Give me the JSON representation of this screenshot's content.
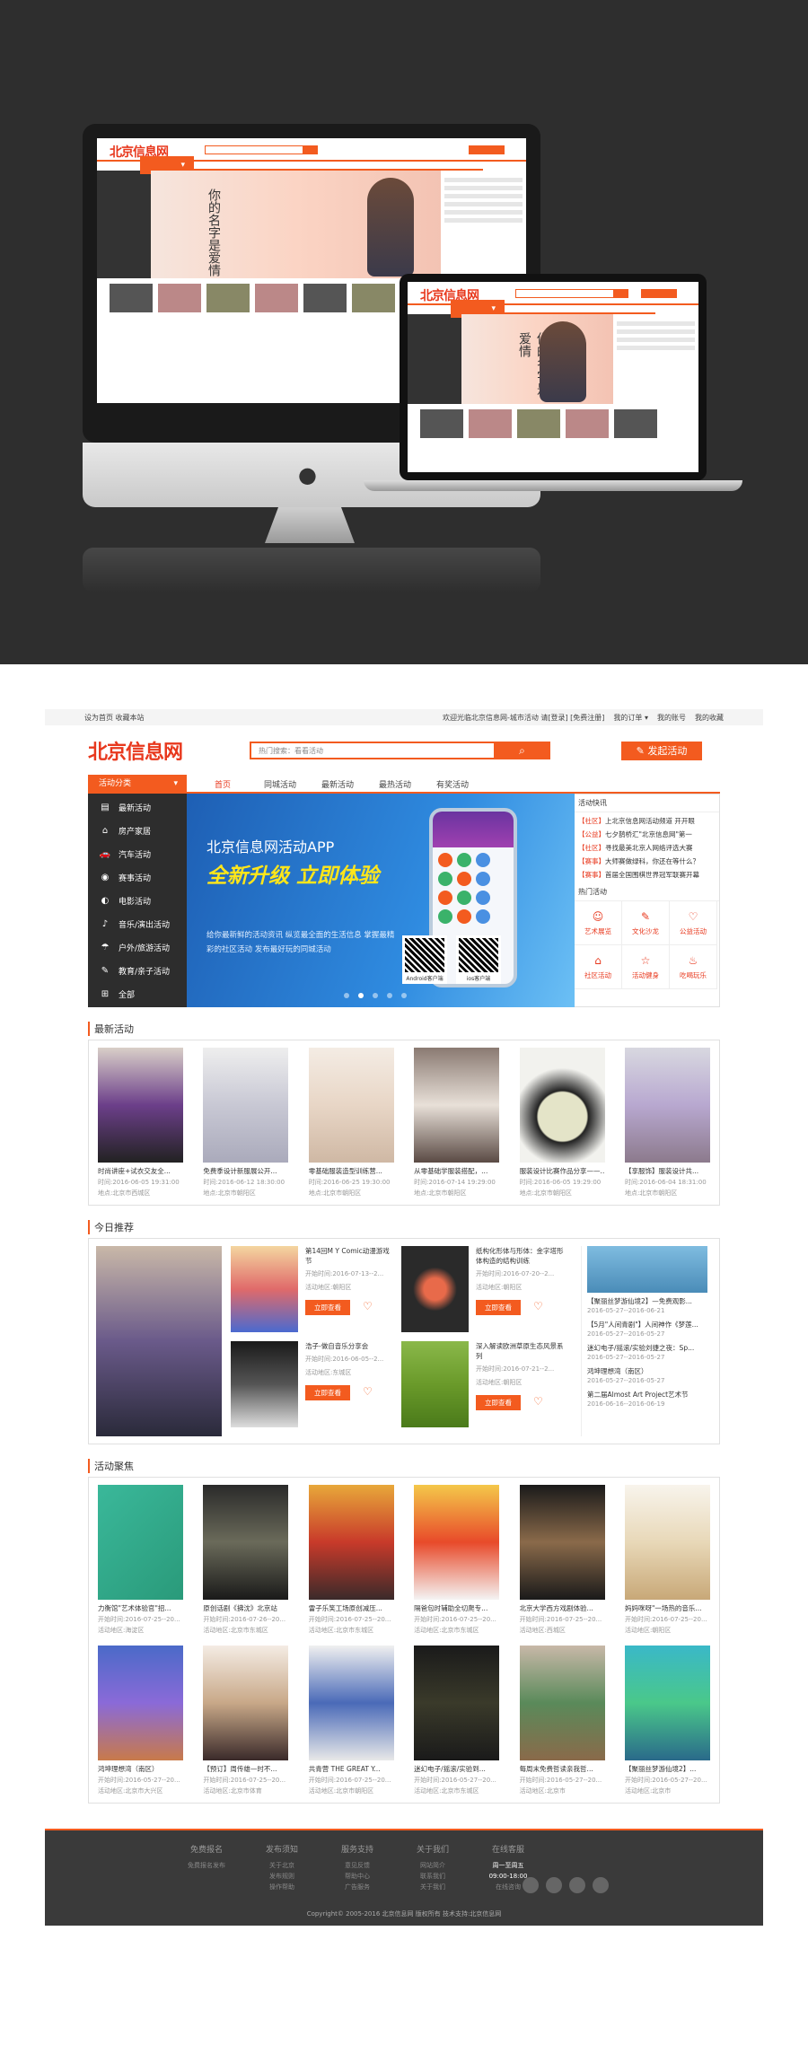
{
  "topbar": {
    "left": "设为首页 收藏本站",
    "welcome": "欢迎光临北京信息网-城市活动 请[登录] [免费注册]",
    "orders": "我的订单 ▾",
    "account": "我的账号",
    "favs": "我的收藏"
  },
  "header": {
    "logo": "北京信息网",
    "search_placeholder": "热门搜索：看看活动",
    "publish": "发起活动"
  },
  "nav": {
    "category": "活动分类",
    "items": [
      "首页",
      "同城活动",
      "最新活动",
      "最热活动",
      "有奖活动"
    ]
  },
  "sidebar": [
    {
      "icon": "▤",
      "label": "最新活动"
    },
    {
      "icon": "⌂",
      "label": "房产家居"
    },
    {
      "icon": "🚗",
      "label": "汽车活动"
    },
    {
      "icon": "◉",
      "label": "赛事活动"
    },
    {
      "icon": "◐",
      "label": "电影活动"
    },
    {
      "icon": "♪",
      "label": "音乐/演出活动"
    },
    {
      "icon": "☂",
      "label": "户外/旅游活动"
    },
    {
      "icon": "✎",
      "label": "教育/亲子活动"
    },
    {
      "icon": "⊞",
      "label": "全部"
    }
  ],
  "banner": {
    "title": "北京信息网活动APP",
    "headline": "全新升级 立即体验",
    "desc": "给你最新鲜的活动资讯 纵览最全面的生活信息 掌握最精彩的社区活动 发布最好玩的同城活动",
    "android": "Android客户端",
    "ios": "ios客户端"
  },
  "aside": {
    "news_title": "活动快讯",
    "news": [
      {
        "tag": "【社区】",
        "text": "上北京信息网活动频道 开开眼"
      },
      {
        "tag": "【公益】",
        "text": "七夕鹊桥汇\"北京信息网\"第一"
      },
      {
        "tag": "【社区】",
        "text": "寻找最美北京人网络评选大赛"
      },
      {
        "tag": "【赛事】",
        "text": "大师赛做绿科，你还在等什么？"
      },
      {
        "tag": "【赛事】",
        "text": "首届全国围棋世界冠军联赛开幕"
      }
    ],
    "hot_title": "热门活动",
    "hot": [
      {
        "icon": "☺",
        "label": "艺术展览"
      },
      {
        "icon": "✎",
        "label": "文化沙龙"
      },
      {
        "icon": "♡",
        "label": "公益活动"
      },
      {
        "icon": "⌂",
        "label": "社区活动"
      },
      {
        "icon": "☆",
        "label": "活动健身"
      },
      {
        "icon": "♨",
        "label": "吃喝玩乐"
      }
    ]
  },
  "latest": {
    "title": "最新活动",
    "items": [
      {
        "title": "时尚讲座+试衣交友全...",
        "time": "时间:2016-06-05 19:31:00",
        "place": "地点:北京市西城区"
      },
      {
        "title": "免费季设计新服展公开...",
        "time": "时间:2016-06-12 18:30:00",
        "place": "地点:北京市朝阳区"
      },
      {
        "title": "零基础服装造型训练营...",
        "time": "时间:2016-06-25 19:30:00",
        "place": "地点:北京市朝阳区"
      },
      {
        "title": "从零基础学服装搭配，...",
        "time": "时间:2016-07-14 19:29:00",
        "place": "地点:北京市朝阳区"
      },
      {
        "title": "服装设计比赛作品分享——...",
        "time": "时间:2016-06-05 19:29:00",
        "place": "地点:北京市朝阳区"
      },
      {
        "title": "【享服饰】服装设计共...",
        "time": "时间:2016-06-04 18:31:00",
        "place": "地点:北京市朝阳区"
      }
    ]
  },
  "today": {
    "title": "今日推荐",
    "items": [
      {
        "title": "第14回M Y Comic动漫游戏节",
        "time": "开始时间:2016-07-13--2...",
        "place": "活动地区:朝阳区"
      },
      {
        "title": "纸构化形体与形体：金字塔形体构造的结构训练",
        "time": "开始时间:2016-07-20--2...",
        "place": "活动地区:朝阳区"
      },
      {
        "title": "浩子-做自音乐分享会",
        "time": "开始时间:2016-06-05--2...",
        "place": "活动地区:东城区"
      },
      {
        "title": "深入解读欧洲草原生态风景系列",
        "time": "开始时间:2016-07-21--2...",
        "place": "活动地区:朝阳区"
      }
    ],
    "button": "立即查看",
    "list": [
      {
        "title": "【聚丽丝梦游仙境2】—免费观影...",
        "meta": "2016-05-27--2016-06-21"
      },
      {
        "title": "【5月\"人间青剧\"】人间神作《梦莲...",
        "meta": "2016-05-27--2016-05-27"
      },
      {
        "title": "迷幻电子/摇滚/实验刘捷之夜：Sp...",
        "meta": "2016-05-27--2016-05-27"
      },
      {
        "title": "鸿坤理想湾（南区）",
        "meta": "2016-05-27--2016-05-27"
      },
      {
        "title": "第二届Almost Art Project艺术节",
        "meta": "2016-06-16--2016-06-19"
      }
    ]
  },
  "focus": {
    "title": "活动聚焦",
    "items": [
      {
        "title": "力衡馆\"艺术体验官\"招...",
        "time": "开始时间:2016-07-25--20...",
        "place": "活动地区:海淀区"
      },
      {
        "title": "原创话剧《拂沈》北京站",
        "time": "开始时间:2016-07-26--20...",
        "place": "活动地区:北京市东城区"
      },
      {
        "title": "雷子乐笑工场原创减压...",
        "time": "开始时间:2016-07-25--20...",
        "place": "活动地区:北京市东城区"
      },
      {
        "title": "隔爸包时辅助全切爬专...",
        "time": "开始时间:2016-07-25--20...",
        "place": "活动地区:北京市东城区"
      },
      {
        "title": "北京大学西方戏剧体验...",
        "time": "开始时间:2016-07-25--20...",
        "place": "活动地区:西城区"
      },
      {
        "title": "妈妈咪呀\"一场热的音乐...",
        "time": "开始时间:2016-07-25--20...",
        "place": "活动地区:朝阳区"
      },
      {
        "title": "鸿坤理想湾（南区）",
        "time": "开始时间:2016-05-27--20...",
        "place": "活动地区:北京市大兴区"
      },
      {
        "title": "【预订】周传雄—时不...",
        "time": "开始时间:2016-07-25--20...",
        "place": "活动地区:北京市体育"
      },
      {
        "title": "共青营 THE GREAT Y...",
        "time": "开始时间:2016-07-25--20...",
        "place": "活动地区:北京市朝阳区"
      },
      {
        "title": "迷幻电子/摇滚/实验到...",
        "time": "开始时间:2016-05-27--20...",
        "place": "活动地区:北京市东城区"
      },
      {
        "title": "每周末免费哲读亲我哲...",
        "time": "开始时间:2016-05-27--20...",
        "place": "活动地区:北京市"
      },
      {
        "title": "【聚丽丝梦游仙境2】...",
        "time": "开始时间:2016-05-27--20...",
        "place": "活动地区:北京市"
      }
    ]
  },
  "footer": {
    "cols": [
      {
        "title": "免费报名",
        "items": [
          "免费报名发布"
        ]
      },
      {
        "title": "发布须知",
        "items": [
          "关于北京",
          "发布规则",
          "操作帮助"
        ]
      },
      {
        "title": "服务支持",
        "items": [
          "意见反馈",
          "帮助中心",
          "广告服务"
        ]
      },
      {
        "title": "关于我们",
        "items": [
          "网站简介",
          "联系我们",
          "关于我们"
        ]
      },
      {
        "title": "在线客服",
        "items": [
          "周一至周五",
          "09:00-18:00",
          "在线咨询"
        ]
      }
    ],
    "copyright": "Copyright© 2005-2016 北京信息网 版权所有 技术支持:北京信息网"
  },
  "colors": {
    "accent": "#f35b1f",
    "dark": "#2d2d2d"
  }
}
